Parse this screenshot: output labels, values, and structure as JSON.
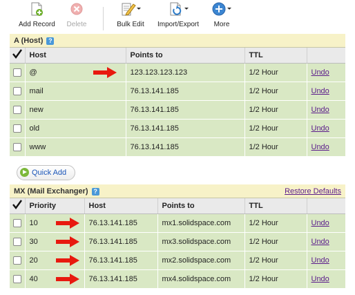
{
  "toolbar": {
    "add_record": "Add Record",
    "delete": "Delete",
    "bulk_edit": "Bulk Edit",
    "import_export": "Import/Export",
    "more": "More"
  },
  "a_section": {
    "title": "A (Host)",
    "help": "?",
    "headers": {
      "host": "Host",
      "points_to": "Points to",
      "ttl": "TTL"
    },
    "rows": [
      {
        "host": "@",
        "points_to": "123.123.123.123",
        "ttl": "1/2 Hour",
        "action": "Undo"
      },
      {
        "host": "mail",
        "points_to": "76.13.141.185",
        "ttl": "1/2 Hour",
        "action": "Undo"
      },
      {
        "host": "new",
        "points_to": "76.13.141.185",
        "ttl": "1/2 Hour",
        "action": "Undo"
      },
      {
        "host": "old",
        "points_to": "76.13.141.185",
        "ttl": "1/2 Hour",
        "action": "Undo"
      },
      {
        "host": "www",
        "points_to": "76.13.141.185",
        "ttl": "1/2 Hour",
        "action": "Undo"
      }
    ]
  },
  "quick_add": "Quick Add",
  "mx_section": {
    "title": "MX (Mail Exchanger)",
    "help": "?",
    "restore": "Restore Defaults",
    "headers": {
      "priority": "Priority",
      "host": "Host",
      "points_to": "Points to",
      "ttl": "TTL"
    },
    "rows": [
      {
        "priority": "10",
        "host": "76.13.141.185",
        "points_to": "mx1.solidspace.com",
        "ttl": "1/2 Hour",
        "action": "Undo"
      },
      {
        "priority": "30",
        "host": "76.13.141.185",
        "points_to": "mx3.solidspace.com",
        "ttl": "1/2 Hour",
        "action": "Undo"
      },
      {
        "priority": "20",
        "host": "76.13.141.185",
        "points_to": "mx2.solidspace.com",
        "ttl": "1/2 Hour",
        "action": "Undo"
      },
      {
        "priority": "40",
        "host": "76.13.141.185",
        "points_to": "mx4.solidspace.com",
        "ttl": "1/2 Hour",
        "action": "Undo"
      }
    ]
  },
  "colors": {
    "row_bg": "#d9e8c4",
    "header_bg": "#f7f2c8",
    "link": "#5a1a8a",
    "arrow": "#e8190f"
  }
}
